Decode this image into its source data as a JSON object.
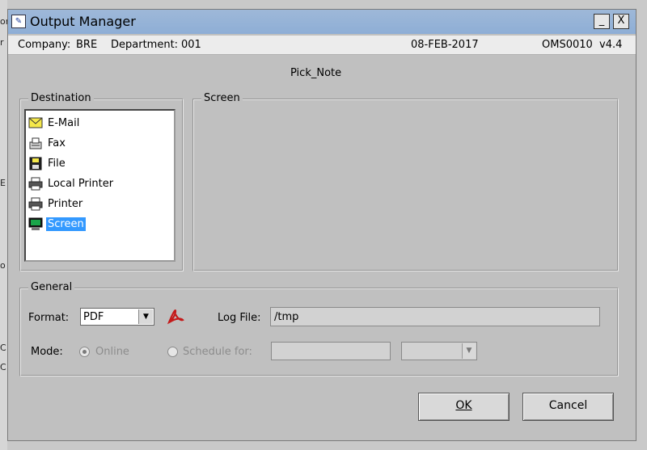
{
  "background_app": {
    "glyphs": [
      "or",
      "r",
      "E",
      "o",
      "C",
      "C"
    ]
  },
  "window": {
    "title": "Output Manager",
    "minimize_label": "_",
    "close_label": "X"
  },
  "infobar": {
    "company_label": "Company:",
    "company_value": "BRE",
    "department_label": "Department:",
    "department_value": "001",
    "date": "08-FEB-2017",
    "version": "OMS0010  v4.4"
  },
  "report_name": "Pick_Note",
  "destination": {
    "legend": "Destination",
    "items": [
      {
        "label": "E-Mail",
        "icon": "envelope-icon"
      },
      {
        "label": "Fax",
        "icon": "fax-icon"
      },
      {
        "label": "File",
        "icon": "floppy-disk-icon"
      },
      {
        "label": "Local Printer",
        "icon": "printer-icon"
      },
      {
        "label": "Printer",
        "icon": "printer-icon"
      },
      {
        "label": "Screen",
        "icon": "monitor-icon",
        "selected": true
      }
    ]
  },
  "screen_group": {
    "legend": "Screen"
  },
  "general": {
    "legend": "General",
    "format_label": "Format:",
    "format_value": "PDF",
    "pdf_icon": "acrobat-pdf-icon",
    "log_file_label": "Log File:",
    "log_file_value": "/tmp",
    "mode_label": "Mode:",
    "online_label": "Online",
    "schedule_label": "Schedule for:",
    "schedule_value": "",
    "schedule_option": ""
  },
  "buttons": {
    "ok": "OK",
    "cancel": "Cancel"
  },
  "colors": {
    "selection": "#3399ff",
    "titlebar": "#9eb8d8",
    "dialog": "#c0c0c0"
  }
}
